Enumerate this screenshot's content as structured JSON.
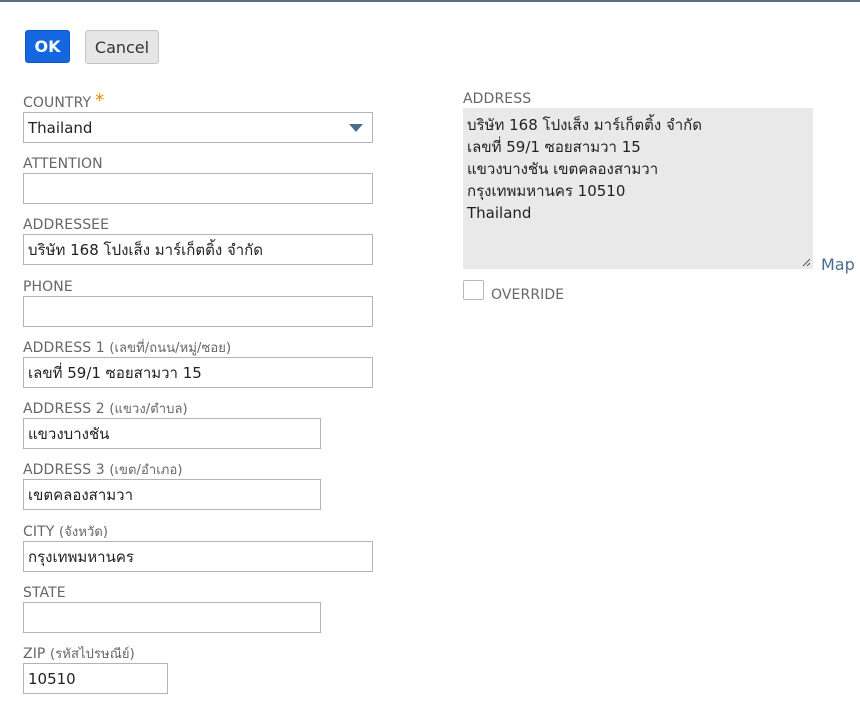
{
  "buttons": {
    "ok_label": "OK",
    "cancel_label": "Cancel"
  },
  "form": {
    "country": {
      "label": "COUNTRY",
      "required_mark": "*",
      "value": "Thailand"
    },
    "attention": {
      "label": "ATTENTION",
      "value": ""
    },
    "addressee": {
      "label": "ADDRESSEE",
      "value": "บริษัท 168 โปงเส็ง มาร์เก็ตติ้ง จำกัด"
    },
    "phone": {
      "label": "PHONE",
      "value": ""
    },
    "address1": {
      "label": "ADDRESS 1",
      "sub": "(เลขที่/ถนน/หมู่/ซอย)",
      "value": "เลขที่ 59/1 ซอยสามวา 15"
    },
    "address2": {
      "label": "ADDRESS 2",
      "sub": "(แขวง/ตำบล)",
      "value": "แขวงบางชัน"
    },
    "address3": {
      "label": "ADDRESS 3",
      "sub": "(เขต/อำเภอ)",
      "value": "เขตคลองสามวา"
    },
    "city": {
      "label": "CITY",
      "sub": "(จังหวัด)",
      "value": "กรุงเทพมหานคร"
    },
    "state": {
      "label": "STATE",
      "value": ""
    },
    "zip": {
      "label": "ZIP",
      "sub": "(รหัสไปรษณีย์)",
      "value": "10510"
    }
  },
  "address_panel": {
    "label": "ADDRESS",
    "lines": [
      "บริษัท 168 โปงเส็ง มาร์เก็ตติ้ง จำกัด",
      "เลขที่ 59/1 ซอยสามวา 15",
      "แขวงบางชัน เขตคลองสามวา",
      "กรุงเทพมหานคร  10510",
      "Thailand"
    ],
    "map_link": "Map",
    "override_label": "OVERRIDE",
    "override_checked": false
  }
}
